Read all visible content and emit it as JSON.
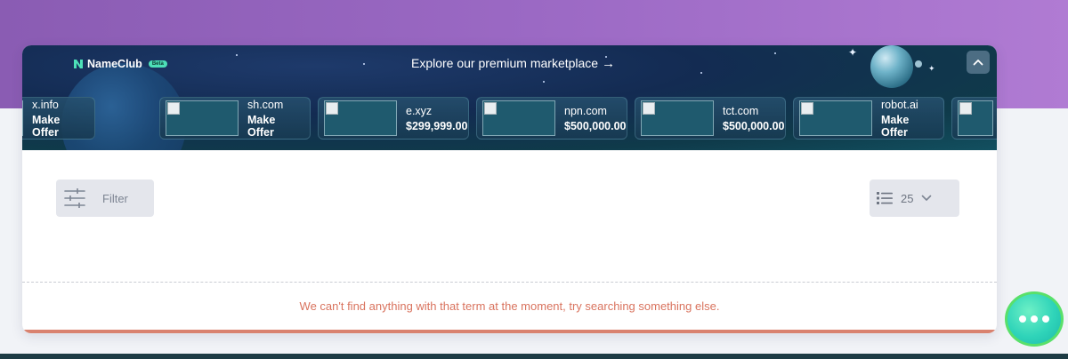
{
  "banner": {
    "brand_name": "NameClub",
    "beta_label": "Beta",
    "explore_text": "Explore our premium marketplace",
    "explore_arrow": "→",
    "collapse_icon": "chevron-up-icon"
  },
  "cards": [
    {
      "name": "x.info",
      "price": "Make Offer"
    },
    {
      "name": "sh.com",
      "price": "Make Offer"
    },
    {
      "name": "e.xyz",
      "price": "$299,999.00"
    },
    {
      "name": "npn.com",
      "price": "$500,000.00"
    },
    {
      "name": "tct.com",
      "price": "$500,000.00"
    },
    {
      "name": "robot.ai",
      "price": "Make Offer"
    }
  ],
  "toolbar": {
    "filter_label": "Filter",
    "filter_icon": "sliders-icon",
    "page_size": "25",
    "list_icon": "list-icon",
    "dropdown_icon": "chevron-down-icon"
  },
  "results": {
    "empty_message": "We can't find anything with that term at the moment, try searching something else."
  },
  "chat": {
    "icon": "chat-bubble-icon"
  },
  "colors": {
    "top_gradient_start": "#8a5cb3",
    "top_gradient_end": "#b07bd3",
    "empty_message": "#d9735e",
    "bottom_bar": "#d9826f",
    "chat_button": "#2fd4b9",
    "beta_badge": "#4de0b8"
  }
}
